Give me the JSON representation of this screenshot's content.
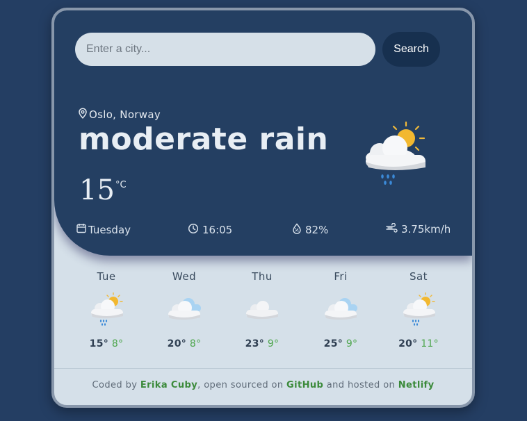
{
  "search": {
    "placeholder": "Enter a city...",
    "value": "",
    "button_label": "Search"
  },
  "current": {
    "location": "Oslo, Norway",
    "description": "moderate rain",
    "temperature": "15",
    "unit": "°C",
    "icon": "sun-cloud-rain-icon",
    "day": "Tuesday",
    "time": "16:05",
    "humidity": "82%",
    "wind": "3.75km/h"
  },
  "forecast": [
    {
      "day": "Tue",
      "high": "15°",
      "low": "8°",
      "icon": "sun-cloud-rain-icon"
    },
    {
      "day": "Wed",
      "high": "20°",
      "low": "8°",
      "icon": "cloudy-icon"
    },
    {
      "day": "Thu",
      "high": "23°",
      "low": "9°",
      "icon": "cloud-icon"
    },
    {
      "day": "Fri",
      "high": "25°",
      "low": "9°",
      "icon": "cloudy-icon"
    },
    {
      "day": "Sat",
      "high": "20°",
      "low": "11°",
      "icon": "sun-cloud-rain-icon"
    }
  ],
  "footer": {
    "prefix": "Coded by ",
    "author": "Erika Cuby",
    "mid1": ", open sourced on ",
    "github": "GitHub",
    "mid2": " and hosted on ",
    "host": "Netlify"
  },
  "colors": {
    "page_background": "#243e63",
    "panel_dark": "#243f62",
    "panel_light": "#d5e0e9",
    "accent_green": "#4fa64e",
    "search_button": "#17304f"
  }
}
